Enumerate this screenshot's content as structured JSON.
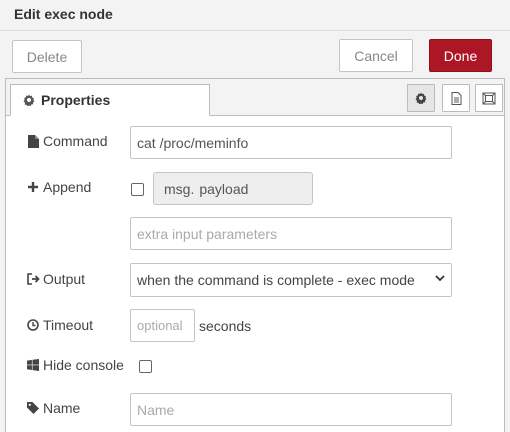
{
  "tray": {
    "title": "Edit exec node"
  },
  "toolbar": {
    "delete_label": "Delete",
    "cancel_label": "Cancel",
    "done_label": "Done"
  },
  "tabs": {
    "properties_label": "Properties"
  },
  "form": {
    "command": {
      "label": "Command",
      "value": "cat /proc/meminfo"
    },
    "append": {
      "label": "Append",
      "checked": false,
      "msg_prefix": "msg.",
      "msg_field": "payload",
      "extra_placeholder": "extra input parameters"
    },
    "output": {
      "label": "Output",
      "selected": "when the command is complete - exec mode"
    },
    "timeout": {
      "label": "Timeout",
      "placeholder": "optional",
      "unit": "seconds"
    },
    "hide_console": {
      "label": "Hide console",
      "checked": false
    },
    "name": {
      "label": "Name",
      "placeholder": "Name"
    }
  },
  "icons": [
    "cog-icon",
    "file-icon",
    "plus-icon",
    "sign-out-icon",
    "clock-icon",
    "windows-icon",
    "tag-icon",
    "chevron-down-icon",
    "description-icon",
    "appearance-icon"
  ],
  "colors": {
    "done_button": "#ad1625",
    "panel_bg": "#f3f3f3"
  }
}
